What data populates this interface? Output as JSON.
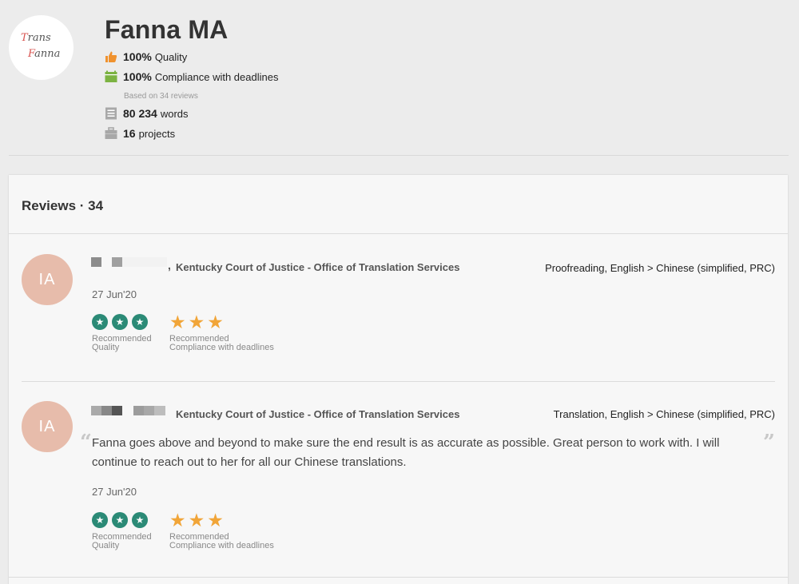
{
  "profile": {
    "logo_line1": "Trans",
    "logo_line2": "Fanna",
    "name": "Fanna MA",
    "quality_value": "100%",
    "quality_label": "Quality",
    "compliance_value": "100%",
    "compliance_label": "Compliance with deadlines",
    "based_on": "Based on 34 reviews",
    "words_value": "80 234",
    "words_label": "words",
    "projects_value": "16",
    "projects_label": "projects"
  },
  "reviews_section": {
    "title": "Reviews · 34",
    "items": [
      {
        "avatar_initials": "IA",
        "separator": ",",
        "organization": "Kentucky Court of Justice - Office of Translation Services",
        "service": "Proofreading, English > Chinese (simplified, PRC)",
        "comment": "",
        "date": "27 Jun'20",
        "quality_rating": 3,
        "quality_label_1": "Recommended",
        "quality_label_2": "Quality",
        "compliance_rating": 3,
        "compliance_label_1": "Recommended",
        "compliance_label_2": "Compliance with deadlines"
      },
      {
        "avatar_initials": "IA",
        "separator": "",
        "organization": "Kentucky Court of Justice - Office of Translation Services",
        "service": "Translation, English > Chinese (simplified, PRC)",
        "comment": "Fanna goes above and beyond to make sure the end result is as accurate as possible. Great person to work with. I will continue to reach out to her for all our Chinese translations.",
        "date": "27 Jun'20",
        "quality_rating": 3,
        "quality_label_1": "Recommended",
        "quality_label_2": "Quality",
        "compliance_rating": 3,
        "compliance_label_1": "Recommended",
        "compliance_label_2": "Compliance with deadlines"
      }
    ]
  },
  "icons": {
    "quality": "thumbs-up-icon",
    "compliance": "calendar-icon",
    "words": "document-icon",
    "projects": "briefcase-icon",
    "quality_rating": "check-circle-icon",
    "compliance_rating": "star-icon"
  },
  "colors": {
    "accent_green": "#2b8a76",
    "star": "#f1a538",
    "avatar": "#e7bcab",
    "thumbs": "#f0922e",
    "calendar": "#7cb342"
  }
}
